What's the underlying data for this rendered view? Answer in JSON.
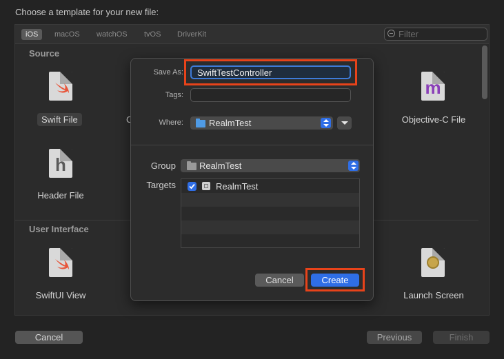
{
  "header": {
    "title": "Choose a template for your new file:"
  },
  "platform_tabs": [
    {
      "label": "iOS",
      "active": true
    },
    {
      "label": "macOS"
    },
    {
      "label": "watchOS"
    },
    {
      "label": "tvOS"
    },
    {
      "label": "DriverKit"
    }
  ],
  "filter": {
    "placeholder": "Filter"
  },
  "sections": {
    "source": "Source",
    "user_interface": "User Interface"
  },
  "templates": {
    "swift_file": "Swift File",
    "objc_file": "Objective-C File",
    "header_file": "Header File",
    "swiftui_view": "SwiftUI View",
    "launch_screen": "Launch Screen",
    "obscured_letter": "C",
    "header_glyph": "h",
    "objc_glyph": "m"
  },
  "footer": {
    "cancel": "Cancel",
    "previous": "Previous",
    "finish": "Finish"
  },
  "save_dialog": {
    "save_as_label": "Save As:",
    "save_as_value": "SwiftTestController",
    "tags_label": "Tags:",
    "where_label": "Where:",
    "where_value": "RealmTest",
    "group_label": "Group",
    "group_value": "RealmTest",
    "targets_label": "Targets",
    "targets": [
      {
        "name": "RealmTest",
        "checked": true
      }
    ],
    "cancel": "Cancel",
    "create": "Create"
  },
  "colors": {
    "accent": "#2f6ee6",
    "highlight": "#e8431a",
    "objc_purple": "#8a3fb8",
    "swift_orange": "#e8553a"
  }
}
